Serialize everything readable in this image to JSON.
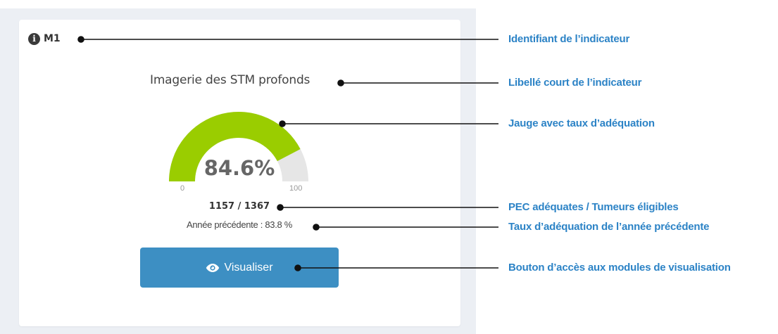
{
  "card": {
    "indicator_id": "M1",
    "indicator_label": "Imagerie des STM profonds",
    "gauge": {
      "value_text": "84.6%",
      "value": 84.6,
      "min": "0",
      "max": "100",
      "fill_color": "#9acd00",
      "track_color": "#e6e6e6"
    },
    "counts": "1157 / 1367",
    "previous_year": "Année précédente : 83.8 %",
    "view_button_label": "Visualiser"
  },
  "callouts": [
    {
      "text": "Identifiant de l’indicateur"
    },
    {
      "text": "Libellé court de l’indicateur"
    },
    {
      "text": "Jauge avec taux d’adéquation"
    },
    {
      "text": "PEC adéquates / Tumeurs éligibles"
    },
    {
      "text": "Taux d’adéquation de l’année précédente"
    },
    {
      "text": "Bouton d’accès aux modules de visualisation"
    }
  ],
  "colors": {
    "callout_text": "#2c83c6",
    "button": "#3d8fc3",
    "panel_bg": "#eceff4"
  },
  "icons": [
    "info-circle-icon",
    "eye-icon"
  ]
}
